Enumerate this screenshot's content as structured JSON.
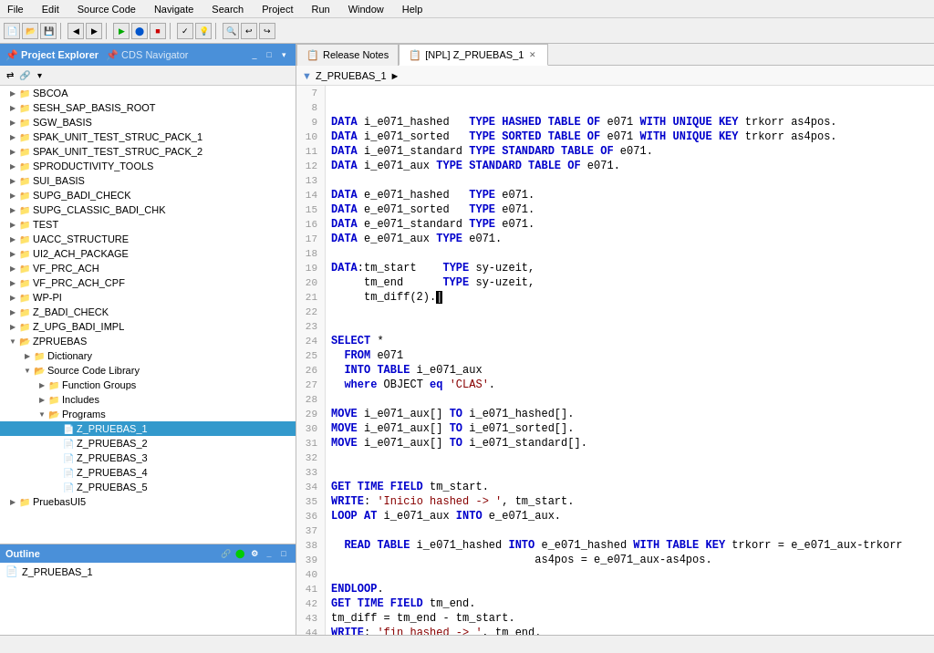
{
  "menuBar": {
    "items": [
      "File",
      "Edit",
      "Source Code",
      "Navigate",
      "Search",
      "Project",
      "Run",
      "Window",
      "Help"
    ]
  },
  "leftPanel": {
    "tabs": [
      {
        "label": "Project Explorer",
        "active": true
      },
      {
        "label": "CDS Navigator",
        "active": false
      }
    ],
    "tree": [
      {
        "id": "SBCOA",
        "label": "SBCOA",
        "level": 1,
        "hasChildren": true,
        "expanded": false,
        "type": "folder"
      },
      {
        "id": "SESH_SAP_BASIS_ROOT",
        "label": "SESH_SAP_BASIS_ROOT",
        "level": 1,
        "hasChildren": true,
        "expanded": false,
        "type": "folder"
      },
      {
        "id": "SGW_BASIS",
        "label": "SGW_BASIS",
        "level": 1,
        "hasChildren": true,
        "expanded": false,
        "type": "folder"
      },
      {
        "id": "SPAK_UNIT_TEST_STRUC_PACK_1",
        "label": "SPAK_UNIT_TEST_STRUC_PACK_1",
        "level": 1,
        "hasChildren": true,
        "expanded": false,
        "type": "folder"
      },
      {
        "id": "SPAK_UNIT_TEST_STRUC_PACK_2",
        "label": "SPAK_UNIT_TEST_STRUC_PACK_2",
        "level": 1,
        "hasChildren": true,
        "expanded": false,
        "type": "folder"
      },
      {
        "id": "SPRODUCTIVITY_TOOLS",
        "label": "SPRODUCTIVITY_TOOLS",
        "level": 1,
        "hasChildren": true,
        "expanded": false,
        "type": "folder"
      },
      {
        "id": "SUI_BASIS",
        "label": "SUI_BASIS",
        "level": 1,
        "hasChildren": true,
        "expanded": false,
        "type": "folder"
      },
      {
        "id": "SUPG_BADI_CHECK",
        "label": "SUPG_BADI_CHECK",
        "level": 1,
        "hasChildren": true,
        "expanded": false,
        "type": "folder"
      },
      {
        "id": "SUPG_CLASSIC_BADI_CHK",
        "label": "SUPG_CLASSIC_BADI_CHK",
        "level": 1,
        "hasChildren": true,
        "expanded": false,
        "type": "folder"
      },
      {
        "id": "TEST",
        "label": "TEST",
        "level": 1,
        "hasChildren": true,
        "expanded": false,
        "type": "folder"
      },
      {
        "id": "UACC_STRUCTURE",
        "label": "UACC_STRUCTURE",
        "level": 1,
        "hasChildren": true,
        "expanded": false,
        "type": "folder"
      },
      {
        "id": "UI2_ACH_PACKAGE",
        "label": "UI2_ACH_PACKAGE",
        "level": 1,
        "hasChildren": true,
        "expanded": false,
        "type": "folder"
      },
      {
        "id": "VF_PRC_ACH",
        "label": "VF_PRC_ACH",
        "level": 1,
        "hasChildren": true,
        "expanded": false,
        "type": "folder"
      },
      {
        "id": "VF_PRC_ACH_CPF",
        "label": "VF_PRC_ACH_CPF",
        "level": 1,
        "hasChildren": true,
        "expanded": false,
        "type": "folder"
      },
      {
        "id": "WP-PI",
        "label": "WP-PI",
        "level": 1,
        "hasChildren": true,
        "expanded": false,
        "type": "folder"
      },
      {
        "id": "Z_BADI_CHECK",
        "label": "Z_BADI_CHECK",
        "level": 1,
        "hasChildren": true,
        "expanded": false,
        "type": "folder"
      },
      {
        "id": "Z_UPG_BADI_IMPL",
        "label": "Z_UPG_BADI_IMPL",
        "level": 1,
        "hasChildren": true,
        "expanded": false,
        "type": "folder"
      },
      {
        "id": "ZPRUEBAS",
        "label": "ZPRUEBAS",
        "level": 1,
        "hasChildren": true,
        "expanded": true,
        "type": "folder"
      },
      {
        "id": "Dictionary",
        "label": "Dictionary",
        "level": 2,
        "hasChildren": true,
        "expanded": false,
        "type": "subfolder"
      },
      {
        "id": "SourceCodeLibrary",
        "label": "Source Code Library",
        "level": 2,
        "hasChildren": true,
        "expanded": true,
        "type": "subfolder"
      },
      {
        "id": "FunctionGroups",
        "label": "Function Groups",
        "level": 3,
        "hasChildren": true,
        "expanded": false,
        "type": "subfolder"
      },
      {
        "id": "Includes",
        "label": "Includes",
        "level": 3,
        "hasChildren": true,
        "expanded": false,
        "type": "subfolder"
      },
      {
        "id": "Programs",
        "label": "Programs",
        "level": 3,
        "hasChildren": true,
        "expanded": true,
        "type": "subfolder"
      },
      {
        "id": "Z_PRUEBAS_1",
        "label": "Z_PRUEBAS_1",
        "level": 4,
        "hasChildren": false,
        "expanded": false,
        "type": "file",
        "selected": true
      },
      {
        "id": "Z_PRUEBAS_2",
        "label": "Z_PRUEBAS_2",
        "level": 4,
        "hasChildren": false,
        "expanded": false,
        "type": "file"
      },
      {
        "id": "Z_PRUEBAS_3",
        "label": "Z_PRUEBAS_3",
        "level": 4,
        "hasChildren": false,
        "expanded": false,
        "type": "file"
      },
      {
        "id": "Z_PRUEBAS_4",
        "label": "Z_PRUEBAS_4",
        "level": 4,
        "hasChildren": false,
        "expanded": false,
        "type": "file"
      },
      {
        "id": "Z_PRUEBAS_5",
        "label": "Z_PRUEBAS_5",
        "level": 4,
        "hasChildren": false,
        "expanded": false,
        "type": "file"
      },
      {
        "id": "PruebasUI5",
        "label": "PruebasUI5",
        "level": 1,
        "hasChildren": true,
        "expanded": false,
        "type": "folder"
      }
    ]
  },
  "rightPanel": {
    "tabs": [
      {
        "label": "Release Notes",
        "active": false,
        "closeable": false,
        "icon": "rn"
      },
      {
        "label": "[NPL] Z_PRUEBAS_1",
        "active": true,
        "closeable": true,
        "icon": "npl"
      }
    ],
    "breadcrumb": "Z_PRUEBAS_1 ▶",
    "lines": [
      {
        "num": 7,
        "content": ""
      },
      {
        "num": 8,
        "content": ""
      },
      {
        "num": 9,
        "content": "DATA i_e071_hashed   TYPE HASHED TABLE OF e071 WITH UNIQUE KEY trkorr as4pos.",
        "tokens": [
          {
            "text": "DATA",
            "class": "kw"
          },
          {
            "text": " i_e071_hashed   ",
            "class": "var"
          },
          {
            "text": "TYPE",
            "class": "kw"
          },
          {
            "text": " ",
            "class": "var"
          },
          {
            "text": "HASHED TABLE OF",
            "class": "kw"
          },
          {
            "text": " e071 ",
            "class": "var"
          },
          {
            "text": "WITH UNIQUE KEY",
            "class": "kw"
          },
          {
            "text": " trkorr as4pos.",
            "class": "var"
          }
        ]
      },
      {
        "num": 10,
        "content": "DATA i_e071_sorted   TYPE SORTED TABLE OF e071 WITH UNIQUE KEY trkorr as4pos.",
        "tokens": [
          {
            "text": "DATA",
            "class": "kw"
          },
          {
            "text": " i_e071_sorted   ",
            "class": "var"
          },
          {
            "text": "TYPE",
            "class": "kw"
          },
          {
            "text": " ",
            "class": "var"
          },
          {
            "text": "SORTED TABLE OF",
            "class": "kw"
          },
          {
            "text": " e071 ",
            "class": "var"
          },
          {
            "text": "WITH UNIQUE KEY",
            "class": "kw"
          },
          {
            "text": " trkorr as4pos.",
            "class": "var"
          }
        ]
      },
      {
        "num": 11,
        "content": "DATA i_e071_standard TYPE STANDARD TABLE OF e071.",
        "tokens": [
          {
            "text": "DATA",
            "class": "kw"
          },
          {
            "text": " i_e071_standard ",
            "class": "var"
          },
          {
            "text": "TYPE",
            "class": "kw"
          },
          {
            "text": " ",
            "class": "var"
          },
          {
            "text": "STANDARD TABLE OF",
            "class": "kw"
          },
          {
            "text": " e071.",
            "class": "var"
          }
        ]
      },
      {
        "num": 12,
        "content": "DATA i_e071_aux TYPE STANDARD TABLE OF e071.",
        "tokens": [
          {
            "text": "DATA",
            "class": "kw"
          },
          {
            "text": " i_e071_aux ",
            "class": "var"
          },
          {
            "text": "TYPE",
            "class": "kw"
          },
          {
            "text": " ",
            "class": "var"
          },
          {
            "text": "STANDARD TABLE OF",
            "class": "kw"
          },
          {
            "text": " e071.",
            "class": "var"
          }
        ]
      },
      {
        "num": 13,
        "content": ""
      },
      {
        "num": 14,
        "content": "DATA e_e071_hashed   TYPE e071.",
        "tokens": [
          {
            "text": "DATA",
            "class": "kw"
          },
          {
            "text": " e_e071_hashed   ",
            "class": "var"
          },
          {
            "text": "TYPE",
            "class": "kw"
          },
          {
            "text": " e071.",
            "class": "var"
          }
        ]
      },
      {
        "num": 15,
        "content": "DATA e_e071_sorted   TYPE e071.",
        "tokens": [
          {
            "text": "DATA",
            "class": "kw"
          },
          {
            "text": " e_e071_sorted   ",
            "class": "var"
          },
          {
            "text": "TYPE",
            "class": "kw"
          },
          {
            "text": " e071.",
            "class": "var"
          }
        ]
      },
      {
        "num": 16,
        "content": "DATA e_e071_standard TYPE e071.",
        "tokens": [
          {
            "text": "DATA",
            "class": "kw"
          },
          {
            "text": " e_e071_standard ",
            "class": "var"
          },
          {
            "text": "TYPE",
            "class": "kw"
          },
          {
            "text": " e071.",
            "class": "var"
          }
        ]
      },
      {
        "num": 17,
        "content": "DATA e_e071_aux TYPE e071.",
        "tokens": [
          {
            "text": "DATA",
            "class": "kw"
          },
          {
            "text": " e_e071_aux ",
            "class": "var"
          },
          {
            "text": "TYPE",
            "class": "kw"
          },
          {
            "text": " e071.",
            "class": "var"
          }
        ]
      },
      {
        "num": 18,
        "content": ""
      },
      {
        "num": 19,
        "content": "DATA:tm_start    TYPE sy-uzeit,",
        "tokens": [
          {
            "text": "DATA",
            "class": "kw"
          },
          {
            "text": ":tm_start    ",
            "class": "var"
          },
          {
            "text": "TYPE",
            "class": "kw"
          },
          {
            "text": " sy-uzeit,",
            "class": "var"
          }
        ]
      },
      {
        "num": 20,
        "content": "     tm_end      TYPE sy-uzeit,",
        "tokens": [
          {
            "text": "     tm_end      ",
            "class": "var"
          },
          {
            "text": "TYPE",
            "class": "kw"
          },
          {
            "text": " sy-uzeit,",
            "class": "var"
          }
        ]
      },
      {
        "num": 21,
        "content": "     tm_diff(2).",
        "tokens": [
          {
            "text": "     tm_diff(2).",
            "class": "var"
          }
        ]
      },
      {
        "num": 22,
        "content": ""
      },
      {
        "num": 23,
        "content": ""
      },
      {
        "num": 24,
        "content": "SELECT *",
        "tokens": [
          {
            "text": "SELECT",
            "class": "kw"
          },
          {
            "text": " *",
            "class": "var"
          }
        ]
      },
      {
        "num": 25,
        "content": "  FROM e071",
        "tokens": [
          {
            "text": "  "
          },
          {
            "text": "FROM",
            "class": "kw"
          },
          {
            "text": " e071",
            "class": "var"
          }
        ]
      },
      {
        "num": 26,
        "content": "  INTO TABLE i_e071_aux",
        "tokens": [
          {
            "text": "  "
          },
          {
            "text": "INTO TABLE",
            "class": "kw"
          },
          {
            "text": " i_e071_aux",
            "class": "var"
          }
        ]
      },
      {
        "num": 27,
        "content": "  where OBJECT eq 'CLAS'.",
        "tokens": [
          {
            "text": "  "
          },
          {
            "text": "where",
            "class": "kw"
          },
          {
            "text": " OBJECT "
          },
          {
            "text": "eq",
            "class": "kw"
          },
          {
            "text": " "
          },
          {
            "text": "'CLAS'",
            "class": "str"
          },
          {
            "text": "."
          }
        ]
      },
      {
        "num": 28,
        "content": ""
      },
      {
        "num": 29,
        "content": "MOVE i_e071_aux[] TO i_e071_hashed[].",
        "tokens": [
          {
            "text": "MOVE",
            "class": "kw"
          },
          {
            "text": " i_e071_aux[] "
          },
          {
            "text": "TO",
            "class": "kw"
          },
          {
            "text": " i_e071_hashed[]."
          }
        ]
      },
      {
        "num": 30,
        "content": "MOVE i_e071_aux[] TO i_e071_sorted[].",
        "tokens": [
          {
            "text": "MOVE",
            "class": "kw"
          },
          {
            "text": " i_e071_aux[] "
          },
          {
            "text": "TO",
            "class": "kw"
          },
          {
            "text": " i_e071_sorted[]."
          }
        ]
      },
      {
        "num": 31,
        "content": "MOVE i_e071_aux[] TO i_e071_standard[].",
        "tokens": [
          {
            "text": "MOVE",
            "class": "kw"
          },
          {
            "text": " i_e071_aux[] "
          },
          {
            "text": "TO",
            "class": "kw"
          },
          {
            "text": " i_e071_standard[]."
          }
        ]
      },
      {
        "num": 32,
        "content": ""
      },
      {
        "num": 33,
        "content": ""
      },
      {
        "num": 34,
        "content": "GET TIME FIELD tm_start.",
        "tokens": [
          {
            "text": "GET TIME FIELD",
            "class": "kw"
          },
          {
            "text": " tm_start."
          }
        ]
      },
      {
        "num": 35,
        "content": "WRITE: 'Inicio hashed -> ', tm_start.",
        "tokens": [
          {
            "text": "WRITE",
            "class": "kw"
          },
          {
            "text": ": "
          },
          {
            "text": "'Inicio hashed -> '",
            "class": "str"
          },
          {
            "text": ", tm_start."
          }
        ]
      },
      {
        "num": 36,
        "content": "LOOP AT i_e071_aux INTO e_e071_aux.",
        "tokens": [
          {
            "text": "LOOP AT",
            "class": "kw"
          },
          {
            "text": " i_e071_aux "
          },
          {
            "text": "INTO",
            "class": "kw"
          },
          {
            "text": " e_e071_aux."
          }
        ]
      },
      {
        "num": 37,
        "content": ""
      },
      {
        "num": 38,
        "content": "  READ TABLE i_e071_hashed INTO e_e071_hashed WITH TABLE KEY trkorr = e_e071_aux-trkorr",
        "tokens": [
          {
            "text": "  "
          },
          {
            "text": "READ TABLE",
            "class": "kw"
          },
          {
            "text": " i_e071_hashed "
          },
          {
            "text": "INTO",
            "class": "kw"
          },
          {
            "text": " e_e071_hashed "
          },
          {
            "text": "WITH TABLE KEY",
            "class": "kw"
          },
          {
            "text": " trkorr = e_e071_aux-trkorr"
          }
        ]
      },
      {
        "num": 39,
        "content": "                               as4pos = e_e071_aux-as4pos.",
        "tokens": [
          {
            "text": "                               as4pos = e_e071_aux-as4pos."
          }
        ]
      },
      {
        "num": 40,
        "content": ""
      },
      {
        "num": 41,
        "content": "ENDLOOP.",
        "tokens": [
          {
            "text": "ENDLOOP",
            "class": "kw"
          },
          {
            "text": "."
          }
        ]
      },
      {
        "num": 42,
        "content": "GET TIME FIELD tm_end.",
        "tokens": [
          {
            "text": "GET TIME FIELD",
            "class": "kw"
          },
          {
            "text": " tm_end."
          }
        ]
      },
      {
        "num": 43,
        "content": "tm_diff = tm_end - tm_start.",
        "tokens": [
          {
            "text": "tm_diff = tm_end - tm_start."
          }
        ]
      },
      {
        "num": 44,
        "content": "WRITE: 'fin hashed -> ', tm_end.",
        "tokens": [
          {
            "text": "WRITE",
            "class": "kw"
          },
          {
            "text": ": "
          },
          {
            "text": "'fin hashed -> '",
            "class": "str"
          },
          {
            "text": ", tm_end."
          }
        ]
      }
    ]
  },
  "outline": {
    "title": "Outline",
    "items": [
      {
        "label": "Z_PRUEBAS_1"
      }
    ]
  },
  "bottomBar": {
    "status": ""
  }
}
